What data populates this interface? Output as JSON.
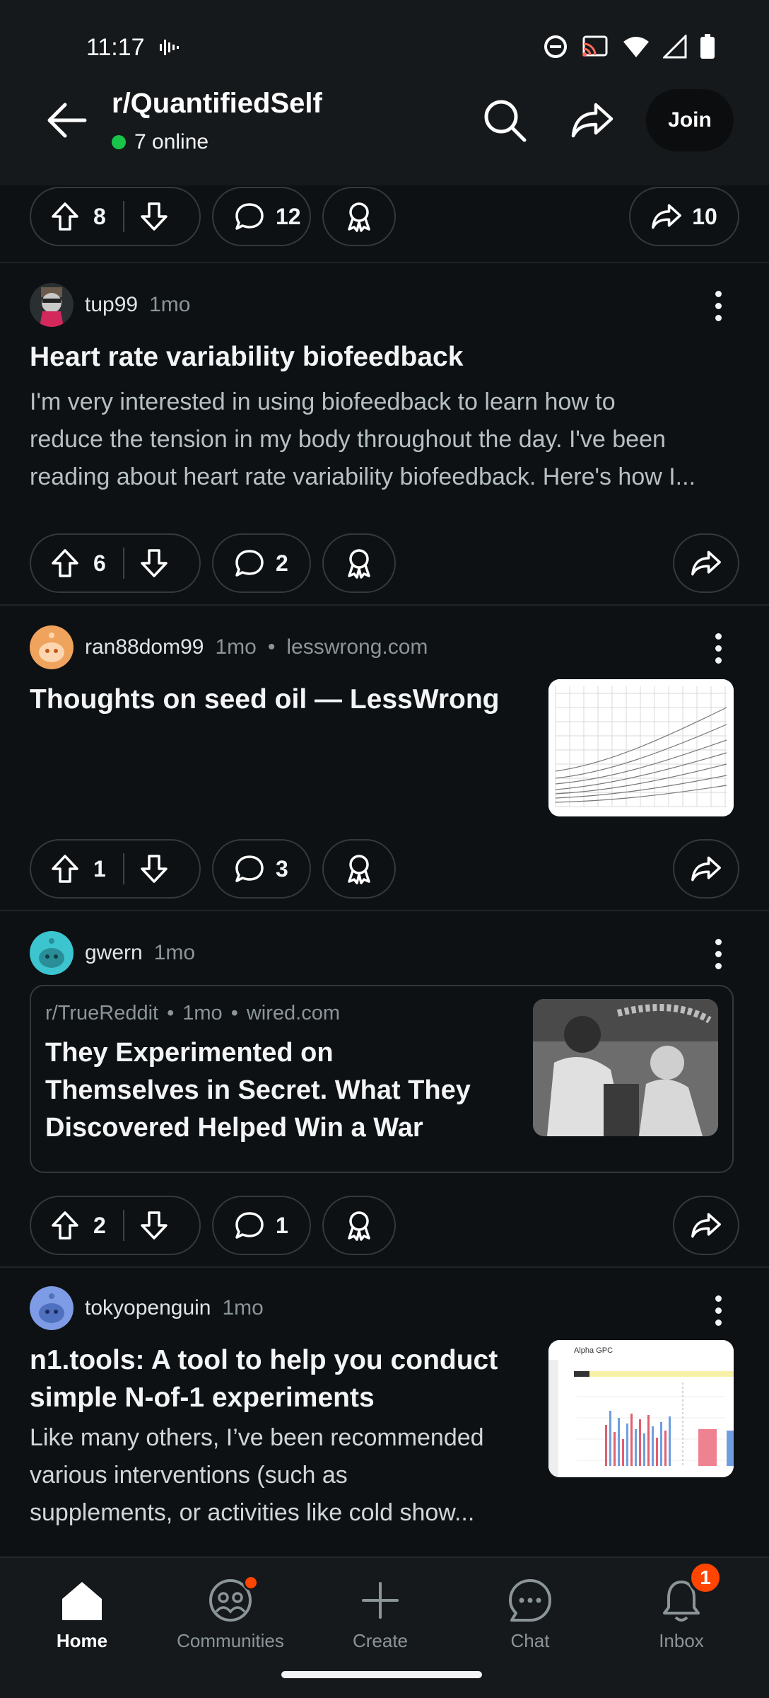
{
  "status_bar": {
    "time": "11:17"
  },
  "header": {
    "subreddit": "r/QuantifiedSelf",
    "online": "7 online",
    "join_label": "Join"
  },
  "top_actions": {
    "votes": "8",
    "comments": "12",
    "shares": "10"
  },
  "posts": [
    {
      "author": "tup99",
      "age": "1mo",
      "title": "Heart rate variability biofeedback",
      "body_lines": [
        "I'm very interested in using biofeedback to learn how to",
        "reduce the tension in my body throughout the day. I've been",
        "reading about heart rate variability biofeedback. Here's how I..."
      ],
      "votes": "6",
      "comments": "2"
    },
    {
      "author": "ran88dom99",
      "age": "1mo",
      "domain": "lesswrong.com",
      "title": "Thoughts on seed oil — LessWrong",
      "votes": "1",
      "comments": "3"
    },
    {
      "author": "gwern",
      "age": "1mo",
      "crosspost": {
        "subreddit": "r/TrueReddit",
        "age": "1mo",
        "domain": "wired.com",
        "title_lines": [
          "They Experimented on",
          "Themselves in Secret. What They",
          "Discovered Helped Win a War"
        ]
      },
      "votes": "2",
      "comments": "1"
    },
    {
      "author": "tokyopenguin",
      "age": "1mo",
      "title_lines": [
        "n1.tools: A tool to help you conduct",
        "simple N-of-1 experiments"
      ],
      "body_lines": [
        "Like many others, I’ve been recommended",
        "various interventions (such as",
        "supplements, or activities like cold show..."
      ],
      "thumb_title": "Alpha GPC"
    }
  ],
  "bottom_nav": {
    "home": "Home",
    "communities": "Communities",
    "create": "Create",
    "chat": "Chat",
    "inbox": "Inbox",
    "inbox_badge": "1"
  },
  "colors": {
    "background": "#0e1113",
    "accent_orange": "#ff4500",
    "online_green": "#19c44a"
  }
}
